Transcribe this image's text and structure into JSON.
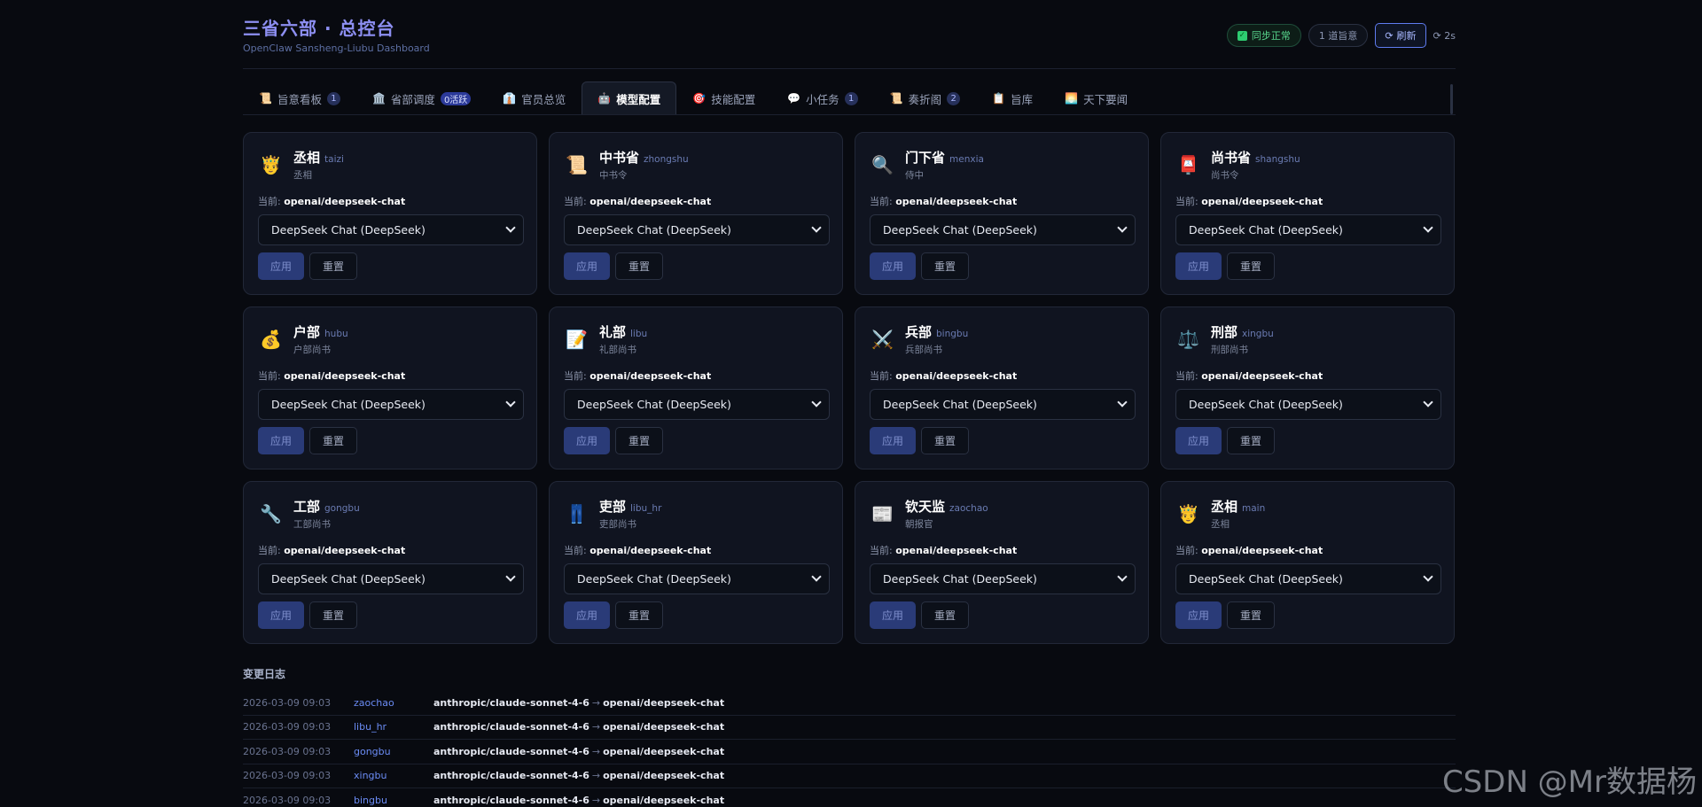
{
  "header": {
    "title": "三省六部 · 总控台",
    "subtitle": "OpenClaw Sansheng-Liubu Dashboard",
    "sync_status": "同步正常",
    "edict_count": "1 道旨意",
    "refresh_label": "刷新",
    "timer": "2s"
  },
  "tabs": [
    {
      "icon": "📜",
      "label": "旨意看板",
      "badge": "1"
    },
    {
      "icon": "🏛️",
      "label": "省部调度",
      "badge": "0活跃"
    },
    {
      "icon": "👔",
      "label": "官员总览",
      "badge": ""
    },
    {
      "icon": "🤖",
      "label": "模型配置",
      "badge": ""
    },
    {
      "icon": "🎯",
      "label": "技能配置",
      "badge": ""
    },
    {
      "icon": "💬",
      "label": "小任务",
      "badge": "1"
    },
    {
      "icon": "📜",
      "label": "奏折阁",
      "badge": "2"
    },
    {
      "icon": "📋",
      "label": "旨库",
      "badge": ""
    },
    {
      "icon": "🌅",
      "label": "天下要闻",
      "badge": ""
    }
  ],
  "cards": [
    {
      "icon": "🤴",
      "name": "丞相",
      "id": "taizi",
      "role": "丞相",
      "current_label": "当前:",
      "current": "openai/deepseek-chat",
      "selected": "DeepSeek Chat (DeepSeek)",
      "apply": "应用",
      "reset": "重置"
    },
    {
      "icon": "📜",
      "name": "中书省",
      "id": "zhongshu",
      "role": "中书令",
      "current_label": "当前:",
      "current": "openai/deepseek-chat",
      "selected": "DeepSeek Chat (DeepSeek)",
      "apply": "应用",
      "reset": "重置"
    },
    {
      "icon": "🔍",
      "name": "门下省",
      "id": "menxia",
      "role": "侍中",
      "current_label": "当前:",
      "current": "openai/deepseek-chat",
      "selected": "DeepSeek Chat (DeepSeek)",
      "apply": "应用",
      "reset": "重置"
    },
    {
      "icon": "📮",
      "name": "尚书省",
      "id": "shangshu",
      "role": "尚书令",
      "current_label": "当前:",
      "current": "openai/deepseek-chat",
      "selected": "DeepSeek Chat (DeepSeek)",
      "apply": "应用",
      "reset": "重置"
    },
    {
      "icon": "💰",
      "name": "户部",
      "id": "hubu",
      "role": "户部尚书",
      "current_label": "当前:",
      "current": "openai/deepseek-chat",
      "selected": "DeepSeek Chat (DeepSeek)",
      "apply": "应用",
      "reset": "重置"
    },
    {
      "icon": "📝",
      "name": "礼部",
      "id": "libu",
      "role": "礼部尚书",
      "current_label": "当前:",
      "current": "openai/deepseek-chat",
      "selected": "DeepSeek Chat (DeepSeek)",
      "apply": "应用",
      "reset": "重置"
    },
    {
      "icon": "⚔️",
      "name": "兵部",
      "id": "bingbu",
      "role": "兵部尚书",
      "current_label": "当前:",
      "current": "openai/deepseek-chat",
      "selected": "DeepSeek Chat (DeepSeek)",
      "apply": "应用",
      "reset": "重置"
    },
    {
      "icon": "⚖️",
      "name": "刑部",
      "id": "xingbu",
      "role": "刑部尚书",
      "current_label": "当前:",
      "current": "openai/deepseek-chat",
      "selected": "DeepSeek Chat (DeepSeek)",
      "apply": "应用",
      "reset": "重置"
    },
    {
      "icon": "🔧",
      "name": "工部",
      "id": "gongbu",
      "role": "工部尚书",
      "current_label": "当前:",
      "current": "openai/deepseek-chat",
      "selected": "DeepSeek Chat (DeepSeek)",
      "apply": "应用",
      "reset": "重置"
    },
    {
      "icon": "👖",
      "name": "吏部",
      "id": "libu_hr",
      "role": "吏部尚书",
      "current_label": "当前:",
      "current": "openai/deepseek-chat",
      "selected": "DeepSeek Chat (DeepSeek)",
      "apply": "应用",
      "reset": "重置"
    },
    {
      "icon": "📰",
      "name": "钦天监",
      "id": "zaochao",
      "role": "朝报官",
      "current_label": "当前:",
      "current": "openai/deepseek-chat",
      "selected": "DeepSeek Chat (DeepSeek)",
      "apply": "应用",
      "reset": "重置"
    },
    {
      "icon": "🤴",
      "name": "丞相",
      "id": "main",
      "role": "丞相",
      "current_label": "当前:",
      "current": "openai/deepseek-chat",
      "selected": "DeepSeek Chat (DeepSeek)",
      "apply": "应用",
      "reset": "重置"
    }
  ],
  "log": {
    "title": "变更日志",
    "rows": [
      {
        "time": "2026-03-09 09:03",
        "agent": "zaochao",
        "from": "anthropic/claude-sonnet-4-6",
        "arrow": "→",
        "to": "openai/deepseek-chat"
      },
      {
        "time": "2026-03-09 09:03",
        "agent": "libu_hr",
        "from": "anthropic/claude-sonnet-4-6",
        "arrow": "→",
        "to": "openai/deepseek-chat"
      },
      {
        "time": "2026-03-09 09:03",
        "agent": "gongbu",
        "from": "anthropic/claude-sonnet-4-6",
        "arrow": "→",
        "to": "openai/deepseek-chat"
      },
      {
        "time": "2026-03-09 09:03",
        "agent": "xingbu",
        "from": "anthropic/claude-sonnet-4-6",
        "arrow": "→",
        "to": "openai/deepseek-chat"
      },
      {
        "time": "2026-03-09 09:03",
        "agent": "bingbu",
        "from": "anthropic/claude-sonnet-4-6",
        "arrow": "→",
        "to": "openai/deepseek-chat"
      }
    ]
  },
  "watermark": "CSDN @Mr数据杨",
  "active_tab_index": 3
}
